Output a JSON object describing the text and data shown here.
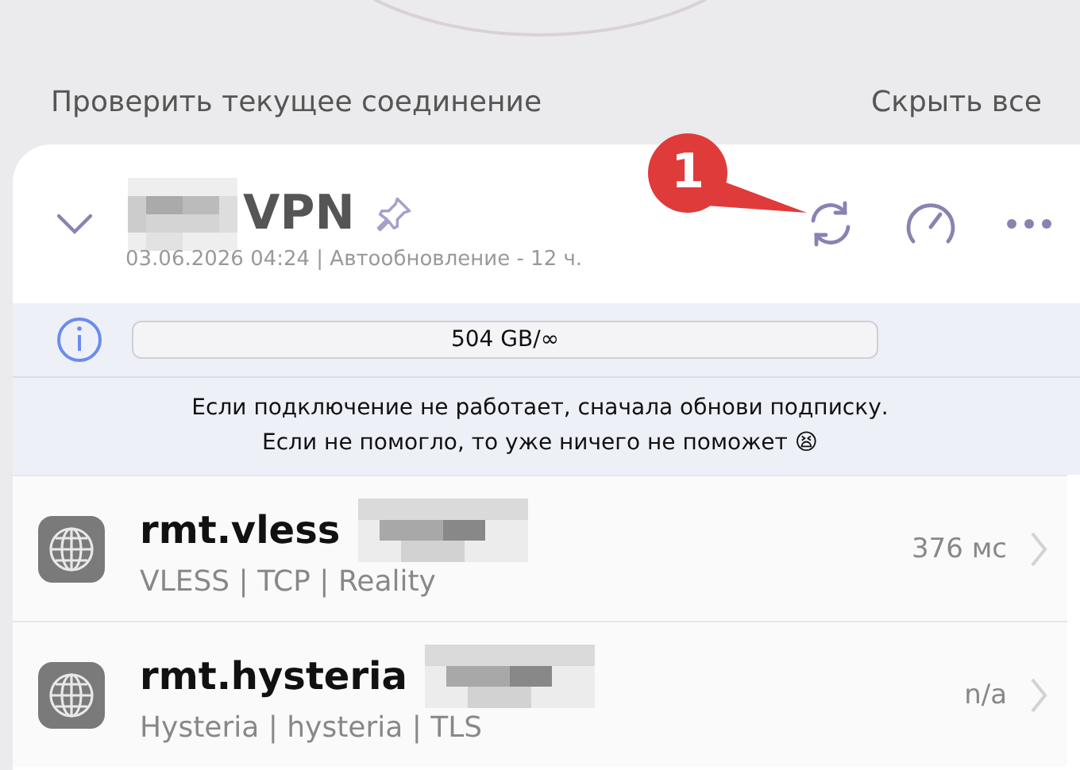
{
  "header": {
    "check_link": "Проверить текущее соединение",
    "hide_link": "Скрыть все"
  },
  "subscription": {
    "name": "VPN",
    "expanded": true,
    "updated": "03.06.2026 04:24 | Автообновление - 12 ч."
  },
  "usage": {
    "text": "504 GB/∞"
  },
  "notice": [
    "Если подключение не работает, сначала обнови подписку.",
    "Если не помогло, то уже ничего не поможет 😫"
  ],
  "servers": [
    {
      "name": "rmt.vless",
      "details": "VLESS | TCP | Reality",
      "latency": "376 мс"
    },
    {
      "name": "rmt.hysteria",
      "details": "Hysteria | hysteria | TLS",
      "latency": "n/a"
    }
  ],
  "callout": {
    "number": "1"
  }
}
